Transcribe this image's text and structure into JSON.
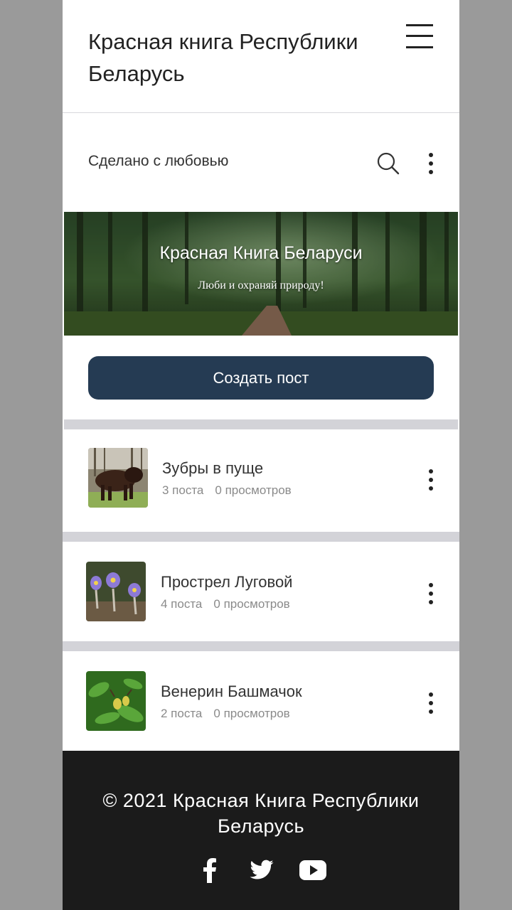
{
  "header": {
    "title": "Красная книга Республики Беларусь",
    "menu_icon": "hamburger-menu-icon"
  },
  "blog": {
    "tagline": "Сделано с любовью",
    "search_icon": "search-icon",
    "more_icon": "more-vertical-icon"
  },
  "banner": {
    "title": "Красная Книга Беларуси",
    "subtitle": "Люби и охраняй природу!"
  },
  "create_post_label": "Создать пост",
  "categories": [
    {
      "name": "Зубры в пуще",
      "posts": "3 поста",
      "views": "0 просмотров",
      "thumb": "bison-photo"
    },
    {
      "name": "Прострел Луговой",
      "posts": "4 поста",
      "views": "0 просмотров",
      "thumb": "pasqueflower-photo"
    },
    {
      "name": "Венерин Башмачок",
      "posts": "2 поста",
      "views": "0 просмотров",
      "thumb": "ladys-slipper-photo"
    }
  ],
  "footer": {
    "copyright": "© 2021 Красная Книга Республики Беларусь",
    "social": [
      "facebook-icon",
      "twitter-icon",
      "youtube-icon"
    ]
  },
  "colors": {
    "button_bg": "#253b53",
    "footer_bg": "#1b1b1b",
    "separator": "#d3d3d8",
    "page_margin": "#9a9a9a"
  }
}
